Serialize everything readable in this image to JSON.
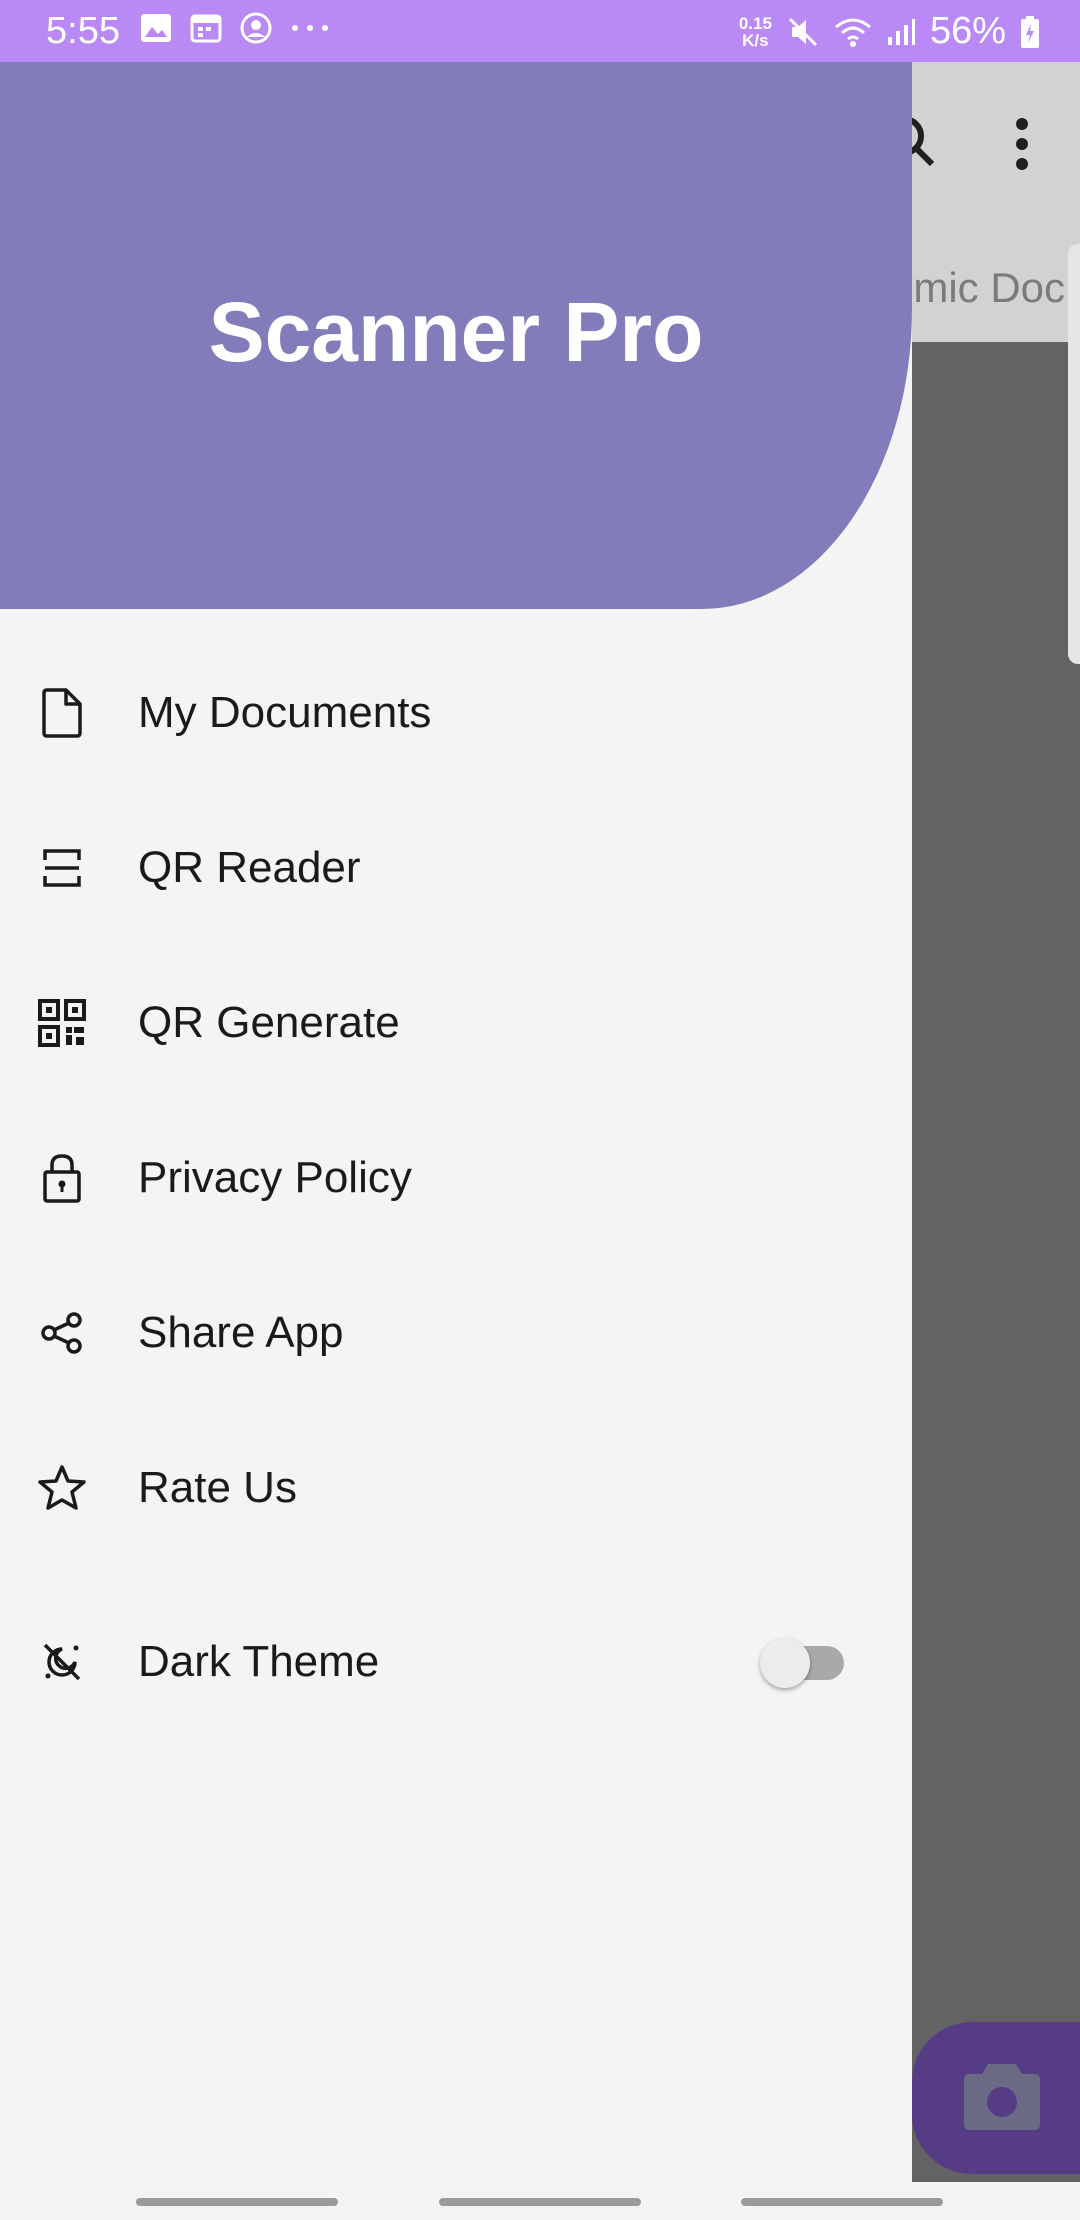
{
  "status_bar": {
    "time": "5:55",
    "net_speed_value": "0.15",
    "net_speed_unit": "K/s",
    "battery_percent": "56%"
  },
  "background_app": {
    "tab_label_partial": "emic Doc"
  },
  "drawer": {
    "title": "Scanner Pro",
    "items": [
      {
        "label": "My Documents",
        "icon": "document-icon"
      },
      {
        "label": "QR Reader",
        "icon": "qr-scan-icon"
      },
      {
        "label": "QR Generate",
        "icon": "qr-code-icon"
      },
      {
        "label": "Privacy Policy",
        "icon": "lock-icon"
      },
      {
        "label": "Share App",
        "icon": "share-icon"
      },
      {
        "label": "Rate Us",
        "icon": "star-icon"
      }
    ],
    "dark_theme": {
      "label": "Dark Theme",
      "icon": "theme-icon",
      "enabled": false
    }
  },
  "colors": {
    "status_bar": "#b98af5",
    "drawer_header": "#827dba",
    "fab": "#553c85",
    "scrim": "#636363"
  }
}
